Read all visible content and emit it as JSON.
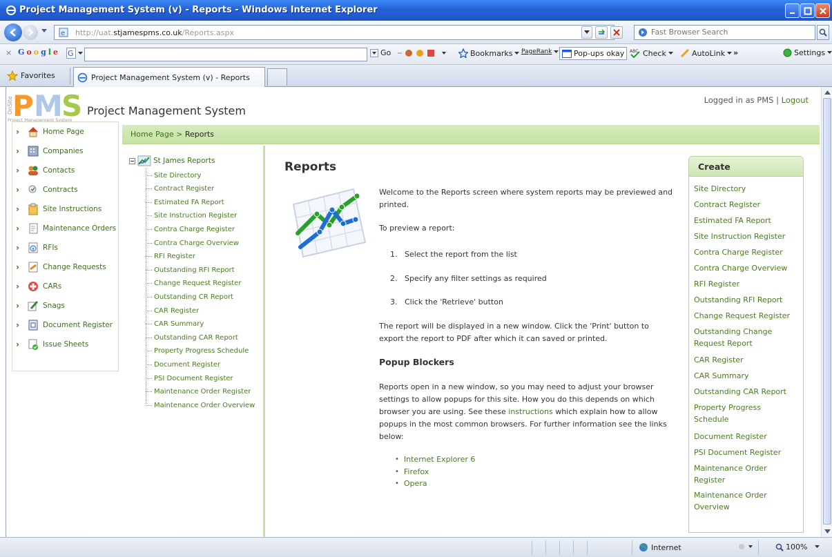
{
  "window": {
    "title": "Project Management System (v) - Reports - Windows Internet Explorer"
  },
  "address": {
    "url_prefix": "http://uat.",
    "url_host": "stjamespms.co.uk",
    "url_path": "/Reports.aspx",
    "search_placeholder": "Fast Browser Search"
  },
  "google_toolbar": {
    "logo": [
      "G",
      "o",
      "o",
      "g",
      "l",
      "e"
    ],
    "go_label": "Go",
    "bookmarks_label": "Bookmarks",
    "pagerank_label": "PageRank",
    "popups_label": "Pop-ups okay",
    "check_label": "Check",
    "autolink_label": "AutoLink",
    "more_label": "»",
    "settings_label": "Settings"
  },
  "tabs": {
    "favorites_label": "Favorites",
    "active_tab_label": "Project Management System (v) - Reports"
  },
  "header": {
    "logo_side": "OnSite",
    "logo_letters": "PMS",
    "logo_caption": "Project Management System",
    "site_title": "Project Management System",
    "logged_in_text": "Logged in as PMS |",
    "logout_label": "Logout"
  },
  "left_menu": [
    {
      "label": "Home Page",
      "icon": "home-icon"
    },
    {
      "label": "Companies",
      "icon": "building-icon"
    },
    {
      "label": "Contacts",
      "icon": "people-icon"
    },
    {
      "label": "Contracts",
      "icon": "contract-icon"
    },
    {
      "label": "Site Instructions",
      "icon": "clipboard-icon"
    },
    {
      "label": "Maintenance Orders",
      "icon": "document-icon"
    },
    {
      "label": "RFIs",
      "icon": "info-document-icon"
    },
    {
      "label": "Change Requests",
      "icon": "change-request-icon"
    },
    {
      "label": "CARs",
      "icon": "red-cross-icon"
    },
    {
      "label": "Snags",
      "icon": "pencil-icon"
    },
    {
      "label": "Document Register",
      "icon": "register-icon"
    },
    {
      "label": "Issue Sheets",
      "icon": "issue-sheet-icon"
    }
  ],
  "breadcrumb": {
    "home": "Home Page",
    "separator": " > ",
    "current": "Reports"
  },
  "tree": {
    "root": "St James Reports",
    "items": [
      "Site Directory",
      "Contract Register",
      "Estimated FA Report",
      "Site Instruction Register",
      "Contra Charge Register",
      "Contra Charge Overview",
      "RFI Register",
      "Outstanding RFI Report",
      "Change Request Register",
      "Outstanding CR Report",
      "CAR Register",
      "CAR Summary",
      "Outstanding CAR Report",
      "Property Progress Schedule",
      "Document Register",
      "PSI Document Register",
      "Maintenance Order Register",
      "Maintenance Order Overview"
    ]
  },
  "main": {
    "heading": "Reports",
    "intro": "Welcome to the Reports screen where system reports may be previewed and printed.",
    "to_preview": "To preview a report:",
    "steps": [
      "1.   Select the report from the list",
      "2.   Specify any filter settings as required",
      "3.   Click the 'Retrieve' button"
    ],
    "display_note": "The report will be displayed in a new window. Click the 'Print' button to export the report to PDF after which it can saved or printed.",
    "popup_heading": "Popup Blockers",
    "popup_text_before": "Reports open in a new window, so you may need to adjust your browser settings to allow popups for this site. How you do this depends on which browser you are using. See these ",
    "popup_link": "instructions",
    "popup_text_after": " which explain how to allow popups in the most common browsers. For further information see the links below:",
    "browser_links": [
      "Internet Explorer 6",
      "Firefox",
      "Opera"
    ]
  },
  "create_panel": {
    "heading": "Create",
    "items": [
      "Site Directory",
      "Contract Register",
      "Estimated FA Report",
      "Site Instruction Register",
      "Contra Charge Register",
      "Contra Charge Overview",
      "RFI Register",
      "Outstanding RFI Report",
      "Change Request Register",
      "Outstanding Change Request Report",
      "CAR Register",
      "CAR Summary",
      "Outstanding CAR Report",
      "Property Progress Schedule",
      "Document Register",
      "PSI Document Register",
      "Maintenance Order Register",
      "Maintenance Order Overview"
    ]
  },
  "status": {
    "zone": "Internet",
    "zoom": "100%"
  },
  "colors": {
    "link_green": "#4a7c1f",
    "breadcrumb_bg": "#c6e2a4",
    "ie_blue": "#2462d8"
  }
}
